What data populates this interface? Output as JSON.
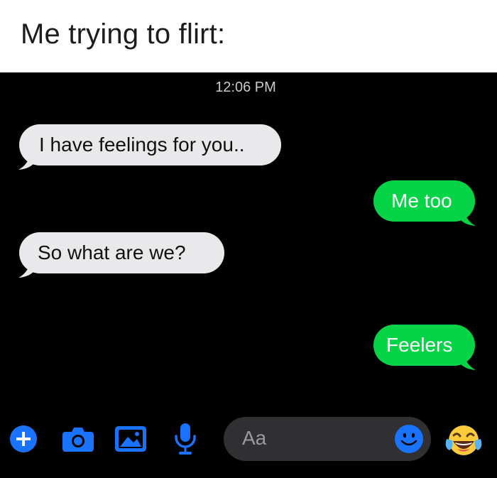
{
  "caption": "Me trying to flirt:",
  "chat": {
    "timestamp": "12:06 PM",
    "messages": [
      {
        "direction": "incoming",
        "text": "I have feelings for you.."
      },
      {
        "direction": "outgoing",
        "text": "Me too"
      },
      {
        "direction": "incoming",
        "text": "So what are we?"
      },
      {
        "direction": "outgoing",
        "text": "Feelers"
      }
    ]
  },
  "composer": {
    "placeholder": "Aa",
    "icons": [
      "plus-icon",
      "camera-icon",
      "image-icon",
      "microphone-icon",
      "smiley-icon",
      "laughing-emoji-icon"
    ]
  },
  "colors": {
    "chat_background": "#000000",
    "incoming_bubble": "#e9e9eb",
    "outgoing_bubble": "#05d447",
    "accent_blue": "#1a73ff"
  }
}
